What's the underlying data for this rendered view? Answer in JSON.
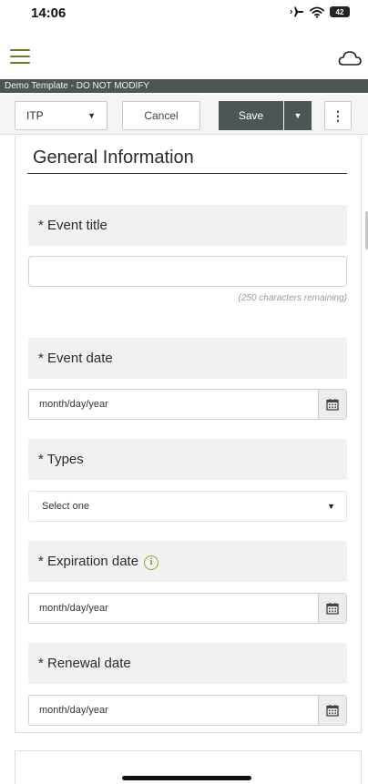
{
  "status_bar": {
    "time": "14:06",
    "battery": "42",
    "icons": [
      "airplane-icon",
      "wifi-icon",
      "battery-icon"
    ]
  },
  "app_bar": {
    "menu_icon": "hamburger-menu-icon",
    "cloud_icon": "cloud-icon"
  },
  "template_banner": "Demo Template - DO NOT MODIFY",
  "toolbar": {
    "form_select_value": "ITP",
    "cancel_label": "Cancel",
    "save_label": "Save",
    "more_label": "⋮"
  },
  "form": {
    "section_title": "General Information",
    "fields": [
      {
        "label": "* Event title",
        "value": "",
        "char_count": "(250 characters remaining)"
      },
      {
        "label": "* Event date",
        "placeholder": "month/day/year"
      },
      {
        "label": "* Types",
        "select_value": "Select one"
      },
      {
        "label": "* Expiration date",
        "placeholder": "month/day/year",
        "has_info": true
      },
      {
        "label": "* Renewal date",
        "placeholder": "month/day/year"
      }
    ]
  },
  "colors": {
    "accent_olive": "#6f7a26",
    "info_olive": "#8a9a1f",
    "dark_slate": "#4c5656",
    "field_label_bg": "#f1f1f1"
  }
}
